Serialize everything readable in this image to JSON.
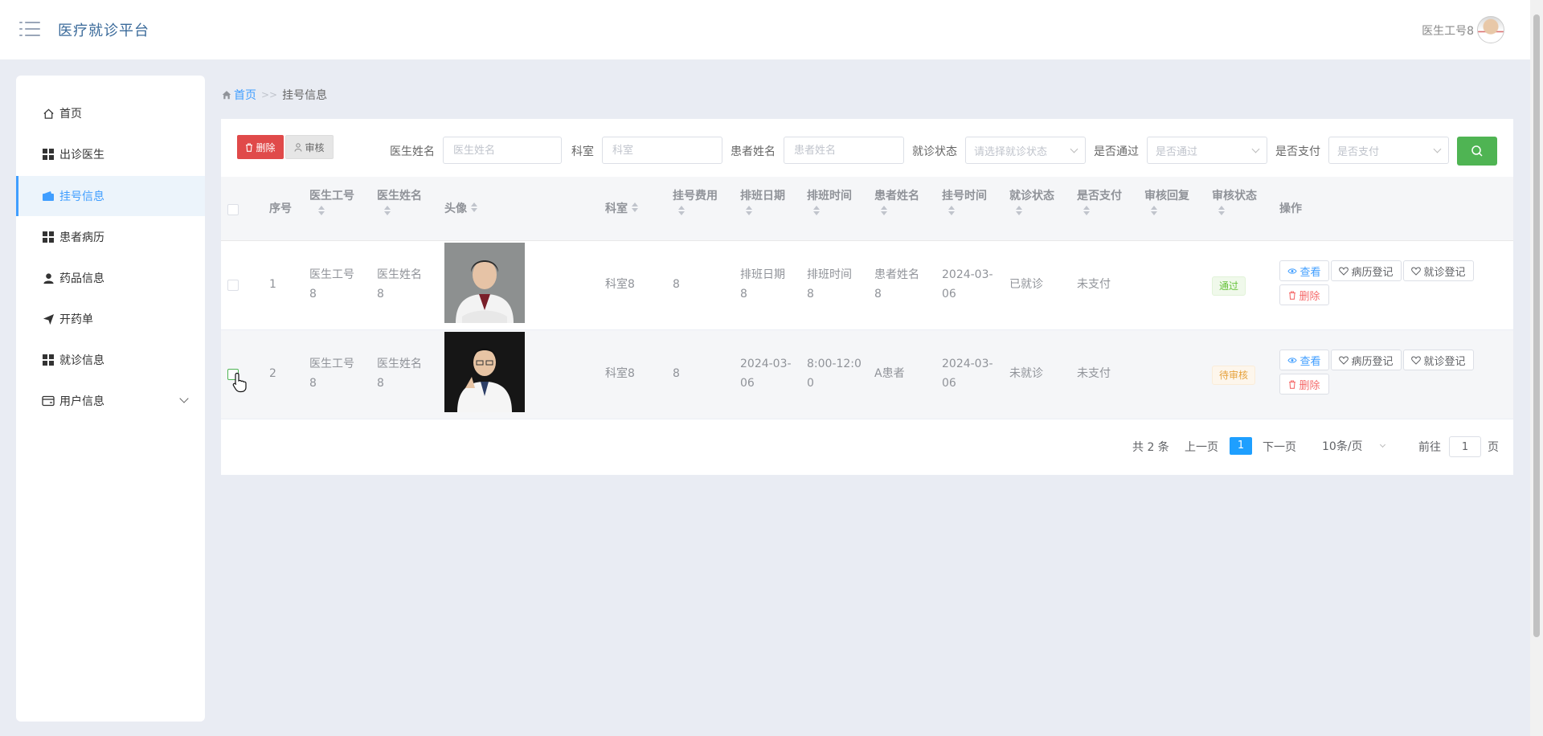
{
  "app": {
    "title": "医疗就诊平台",
    "user": "医生工号8"
  },
  "sidebar": {
    "items": [
      {
        "label": "首页",
        "icon": "home-icon"
      },
      {
        "label": "出诊医生",
        "icon": "grid-icon"
      },
      {
        "label": "挂号信息",
        "icon": "wallet-icon",
        "active": true
      },
      {
        "label": "患者病历",
        "icon": "grid-icon"
      },
      {
        "label": "药品信息",
        "icon": "person-icon"
      },
      {
        "label": "开药单",
        "icon": "send-icon"
      },
      {
        "label": "就诊信息",
        "icon": "grid-icon"
      },
      {
        "label": "用户信息",
        "icon": "card-icon",
        "expandable": true
      }
    ]
  },
  "breadcrumb": {
    "home": "首页",
    "separator": ">>",
    "current": "挂号信息"
  },
  "toolbar": {
    "delete": "删除",
    "audit": "审核"
  },
  "filters": {
    "doctor_name": {
      "label": "医生姓名",
      "placeholder": "医生姓名"
    },
    "department": {
      "label": "科室",
      "placeholder": "科室"
    },
    "patient_name": {
      "label": "患者姓名",
      "placeholder": "患者姓名"
    },
    "visit_status": {
      "label": "就诊状态",
      "placeholder": "请选择就诊状态"
    },
    "passed": {
      "label": "是否通过",
      "placeholder": "是否通过"
    },
    "paid": {
      "label": "是否支付",
      "placeholder": "是否支付"
    }
  },
  "table": {
    "headers": {
      "index": "序号",
      "doctor_id": "医生工号",
      "doctor_name": "医生姓名",
      "avatar": "头像",
      "department": "科室",
      "fee": "挂号费用",
      "schedule_date": "排班日期",
      "schedule_time": "排班时间",
      "patient_name": "患者姓名",
      "register_time": "挂号时间",
      "visit_status": "就诊状态",
      "paid": "是否支付",
      "audit_reply": "审核回复",
      "audit_status": "审核状态",
      "actions": "操作"
    },
    "rows": [
      {
        "index": "1",
        "doctor_id": "医生工号\n8",
        "doctor_name": "医生姓名\n8",
        "department": "科室8",
        "fee": "8",
        "schedule_date": "排班日期\n8",
        "schedule_time": "排班时间\n8",
        "patient_name": "患者姓名\n8",
        "register_time": "2024-03-\n06",
        "visit_status": "已就诊",
        "paid": "未支付",
        "audit_reply": "",
        "audit_status": "通过"
      },
      {
        "index": "2",
        "doctor_id": "医生工号\n8",
        "doctor_name": "医生姓名\n8",
        "department": "科室8",
        "fee": "8",
        "schedule_date": "2024-03-\n06",
        "schedule_time": "8:00-12:0\n0",
        "patient_name": "A患者",
        "register_time": "2024-03-\n06",
        "visit_status": "未就诊",
        "paid": "未支付",
        "audit_reply": "",
        "audit_status": "待审核"
      }
    ],
    "actions": {
      "view": "查看",
      "record": "病历登记",
      "visit": "就诊登记",
      "delete": "删除"
    }
  },
  "pagination": {
    "total": "共 2 条",
    "prev": "上一页",
    "current": "1",
    "next": "下一页",
    "page_size": "10条/页",
    "goto_label": "前往",
    "goto_value": "1",
    "page_unit": "页"
  },
  "colors": {
    "primary": "#409eff",
    "danger": "#e04a4a",
    "success": "#4fb453",
    "warning": "#e6a23c"
  }
}
